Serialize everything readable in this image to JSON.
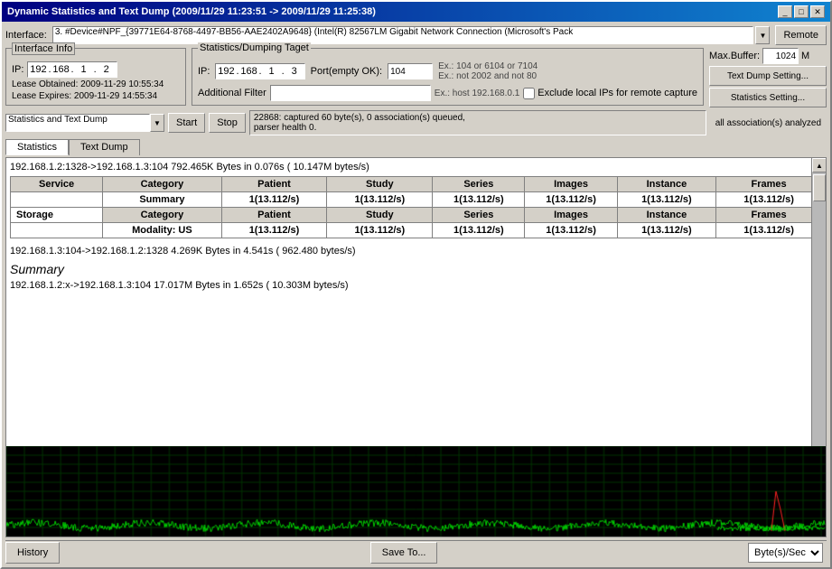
{
  "window": {
    "title": "Dynamic Statistics and Text Dump (2009/11/29 11:23:51 -> 2009/11/29 11:25:38)",
    "controls": [
      "_",
      "□",
      "✕"
    ]
  },
  "toolbar": {
    "interface_label": "Interface:",
    "interface_value": "3. #Device#NPF_{39771E64-8768-4497-BB56-AAE2402A9648} (Intel(R) 82567LM Gigabit Network Connection (Microsoft's Pack",
    "remote_btn": "Remote"
  },
  "interface_info": {
    "group_label": "Interface Info",
    "ip_label": "IP:",
    "ip_value": "192 . 168 . 1 . 2",
    "lease_obtained": "Lease Obtained: 2009-11-29 10:55:34",
    "lease_expires": "Lease Expires: 2009-11-29 14:55:34"
  },
  "stats_group": {
    "group_label": "Statistics/Dumping Taget",
    "ip_label": "IP:",
    "ip_value": "192 . 168 . 1 . 3",
    "port_label": "Port(empty OK):",
    "port_value": "104",
    "example1": "Ex.: 104 or 6104 or 7104",
    "example2": "Ex.: not 2002 and not 80",
    "filter_label": "Additional Filter",
    "filter_value": "",
    "filter_example": "Ex.: host 192.168.0.1",
    "checkbox_label": "Exclude local IPs for remote capture"
  },
  "max_buffer": {
    "label": "Max.Buffer:",
    "value": "1024",
    "unit": "M"
  },
  "right_buttons": {
    "text_dump": "Text Dump Setting...",
    "statistics": "Statistics Setting..."
  },
  "action_bar": {
    "combo_label": "Statistics and Text Dump",
    "start_btn": "Start",
    "stop_btn": "Stop",
    "status_line1": "22868: captured 60 byte(s), 0 association(s) queued,",
    "status_line2": "parser health 0.",
    "status_right": "all association(s) analyzed"
  },
  "tabs": [
    {
      "label": "Statistics",
      "active": true
    },
    {
      "label": "Text Dump",
      "active": false
    }
  ],
  "statistics": {
    "connection1": {
      "header": "192.168.1.2:1328->192.168.1.3:104      792.465K Bytes in 0.076s ( 10.147M bytes/s)",
      "table1": {
        "columns": [
          "Service",
          "Category",
          "Patient",
          "Study",
          "Series",
          "Images",
          "Instance",
          "Frames"
        ],
        "rows": [
          {
            "service": "",
            "category": "Summary",
            "patient": "1(13.112/s)",
            "study": "1(13.112/s)",
            "series": "1(13.112/s)",
            "images": "1(13.112/s)",
            "instance": "1(13.112/s)",
            "frames": "1(13.112/s)"
          }
        ]
      },
      "table2": {
        "columns": [
          "Service",
          "Category",
          "Patient",
          "Study",
          "Series",
          "Images",
          "Instance",
          "Frames"
        ],
        "rows": [
          {
            "service": "Storage",
            "category": "Category",
            "patient": "Patient",
            "study": "Study",
            "series": "Series",
            "images": "Images",
            "instance": "Instance",
            "frames": "Frames"
          },
          {
            "service": "",
            "category": "Modality: US",
            "patient": "1(13.112/s)",
            "study": "1(13.112/s)",
            "series": "1(13.112/s)",
            "images": "1(13.112/s)",
            "instance": "1(13.112/s)",
            "frames": "1(13.112/s)"
          }
        ]
      }
    },
    "connection2": {
      "header": "192.168.1.3:104->192.168.1.2:1328      4.269K Bytes in 4.541s ( 962.480 bytes/s)"
    },
    "summary_label": "Summary",
    "connection3": {
      "header": "192.168.1.2:x->192.168.1.3:104      17.017M Bytes in 1.652s ( 10.303M bytes/s)"
    }
  },
  "bottom_bar": {
    "history_btn": "History",
    "save_btn": "Save To...",
    "unit_select": "Byte(s)/Sec"
  }
}
